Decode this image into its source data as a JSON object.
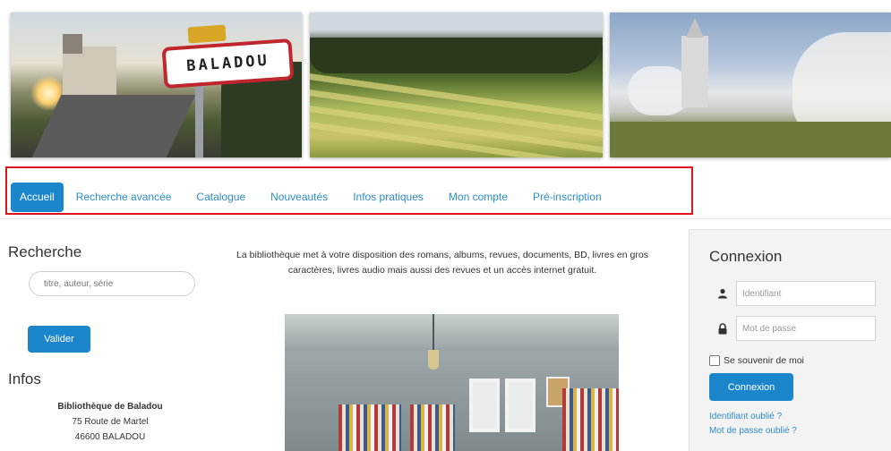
{
  "banner": {
    "photo1_sign_text": "BALADOU"
  },
  "nav": {
    "items": [
      {
        "label": "Accueil",
        "active": true
      },
      {
        "label": "Recherche avancée"
      },
      {
        "label": "Catalogue"
      },
      {
        "label": "Nouveautés"
      },
      {
        "label": "Infos pratiques"
      },
      {
        "label": "Mon compte"
      },
      {
        "label": "Pré-inscription"
      }
    ],
    "accent": "#1c86cc",
    "highlight_border": "#e0151b"
  },
  "left": {
    "search_title": "Recherche",
    "search_placeholder": "titre, auteur, série",
    "validate_label": "Valider",
    "infos_title": "Infos",
    "library_name": "Bibliothèque de Baladou",
    "address_line1": "75 Route de Martel",
    "address_line2": "46600 BALADOU"
  },
  "main": {
    "intro_text": "La bibliothèque met à votre disposition des romans, albums, revues, documents, BD, livres en gros caractères, livres audio mais aussi des revues et un accès internet gratuit."
  },
  "login": {
    "title": "Connexion",
    "username_placeholder": "Identifiant",
    "password_placeholder": "Mot de passe",
    "username_icon": "user-icon",
    "password_icon": "lock-icon",
    "remember_label": "Se souvenir de moi",
    "submit_label": "Connexion",
    "forgot_id": "Identifiant oublié ?",
    "forgot_password": "Mot de passe oublié ?"
  }
}
